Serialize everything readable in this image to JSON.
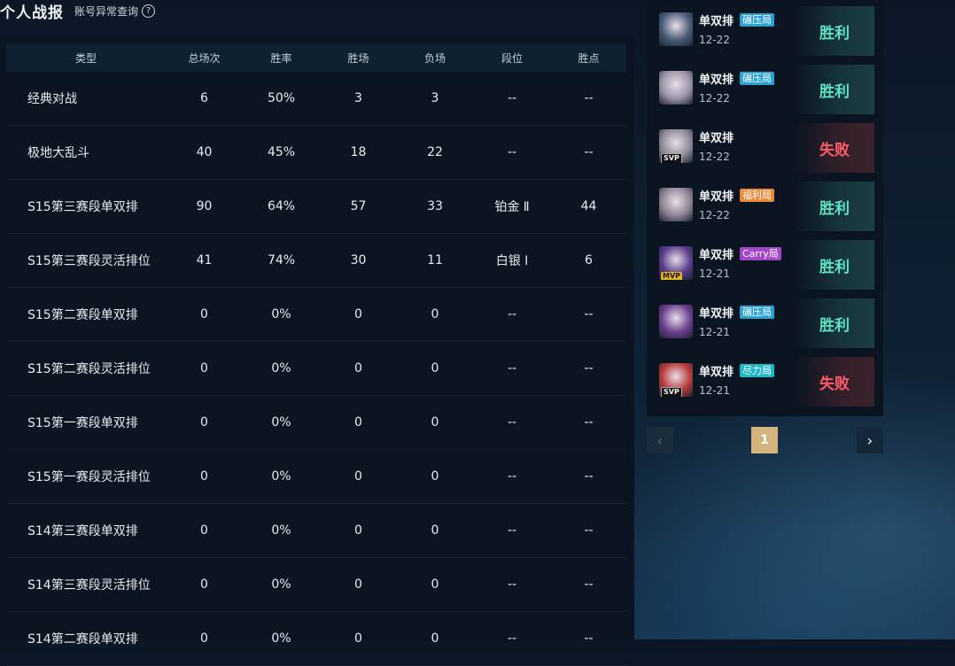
{
  "header": {
    "title": "个人战报",
    "query_link": "账号异常查询",
    "help_icon": "?"
  },
  "table": {
    "columns": [
      "类型",
      "总场次",
      "胜率",
      "胜场",
      "负场",
      "段位",
      "胜点"
    ],
    "rows": [
      [
        "经典对战",
        "6",
        "50%",
        "3",
        "3",
        "--",
        "--"
      ],
      [
        "极地大乱斗",
        "40",
        "45%",
        "18",
        "22",
        "--",
        "--"
      ],
      [
        "S15第三赛段单双排",
        "90",
        "64%",
        "57",
        "33",
        "铂金 Ⅱ",
        "44"
      ],
      [
        "S15第三赛段灵活排位",
        "41",
        "74%",
        "30",
        "11",
        "白银 Ⅰ",
        "6"
      ],
      [
        "S15第二赛段单双排",
        "0",
        "0%",
        "0",
        "0",
        "--",
        "--"
      ],
      [
        "S15第二赛段灵活排位",
        "0",
        "0%",
        "0",
        "0",
        "--",
        "--"
      ],
      [
        "S15第一赛段单双排",
        "0",
        "0%",
        "0",
        "0",
        "--",
        "--"
      ],
      [
        "S15第一赛段灵活排位",
        "0",
        "0%",
        "0",
        "0",
        "--",
        "--"
      ],
      [
        "S14第三赛段单双排",
        "0",
        "0%",
        "0",
        "0",
        "--",
        "--"
      ],
      [
        "S14第三赛段灵活排位",
        "0",
        "0%",
        "0",
        "0",
        "--",
        "--"
      ],
      [
        "S14第二赛段单双排",
        "0",
        "0%",
        "0",
        "0",
        "--",
        "--"
      ]
    ]
  },
  "matches": [
    {
      "mode": "单双排",
      "tag": "碾压局",
      "tag_color": "#2aa3d3",
      "date": "12-22",
      "result": "胜利",
      "win": true,
      "badge": "",
      "hue": "#4a5b78"
    },
    {
      "mode": "单双排",
      "tag": "碾压局",
      "tag_color": "#2aa3d3",
      "date": "12-22",
      "result": "胜利",
      "win": true,
      "badge": "",
      "hue": "#9b93a8"
    },
    {
      "mode": "单双排",
      "tag": "",
      "tag_color": "",
      "date": "12-22",
      "result": "失败",
      "win": false,
      "badge": "SVP",
      "hue": "#8f8a99"
    },
    {
      "mode": "单双排",
      "tag": "福利局",
      "tag_color": "#e98a3a",
      "date": "12-22",
      "result": "胜利",
      "win": true,
      "badge": "",
      "hue": "#8d8595"
    },
    {
      "mode": "单双排",
      "tag": "Carry局",
      "tag_color": "#a247c9",
      "date": "12-21",
      "result": "胜利",
      "win": true,
      "badge": "MVP",
      "hue": "#5b3c8c"
    },
    {
      "mode": "单双排",
      "tag": "碾压局",
      "tag_color": "#2aa3d3",
      "date": "12-21",
      "result": "胜利",
      "win": true,
      "badge": "",
      "hue": "#6a3f8f"
    },
    {
      "mode": "单双排",
      "tag": "尽力局",
      "tag_color": "#1fb8c8",
      "date": "12-21",
      "result": "失败",
      "win": false,
      "badge": "SVP",
      "hue": "#b83a3a"
    }
  ],
  "pagination": {
    "prev": "‹",
    "current": "1",
    "next": "›"
  }
}
